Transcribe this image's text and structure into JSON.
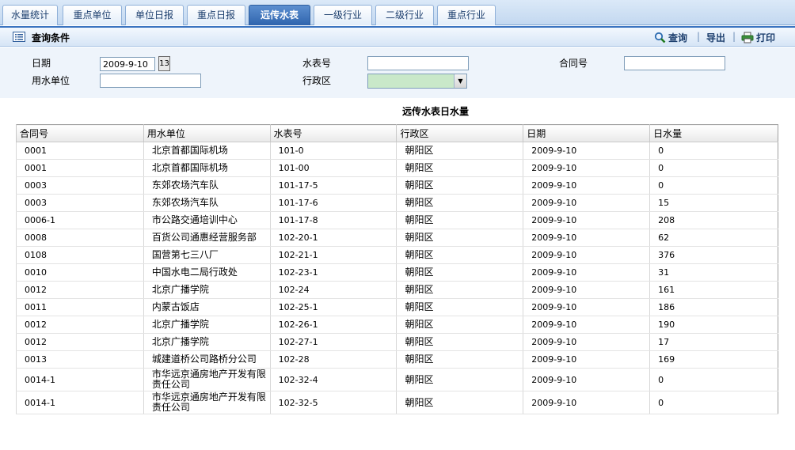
{
  "tabs": [
    {
      "label": "水量统计",
      "active": false
    },
    {
      "label": "重点单位",
      "active": false
    },
    {
      "label": "单位日报",
      "active": false
    },
    {
      "label": "重点日报",
      "active": false
    },
    {
      "label": "远传水表",
      "active": true
    },
    {
      "label": "一级行业",
      "active": false
    },
    {
      "label": "二级行业",
      "active": false
    },
    {
      "label": "重点行业",
      "active": false
    }
  ],
  "query_bar": {
    "title": "查询条件",
    "search_label": "查询",
    "export_label": "导出",
    "print_label": "打印"
  },
  "form": {
    "date_label": "日期",
    "date_value": "2009-9-10",
    "calendar_button": "13",
    "meter_label": "水表号",
    "meter_value": "",
    "contract_label": "合同号",
    "contract_value": "",
    "unit_label": "用水单位",
    "unit_value": "",
    "district_label": "行政区",
    "district_value": ""
  },
  "report_title": "远传水表日水量",
  "table": {
    "columns": [
      "合同号",
      "用水单位",
      "水表号",
      "行政区",
      "日期",
      "日水量"
    ],
    "rows": [
      [
        "0001",
        "北京首都国际机场",
        "101-0",
        "朝阳区",
        "2009-9-10",
        "0"
      ],
      [
        "0001",
        "北京首都国际机场",
        "101-00",
        "朝阳区",
        "2009-9-10",
        "0"
      ],
      [
        "0003",
        "东郊农场汽车队",
        "101-17-5",
        "朝阳区",
        "2009-9-10",
        "0"
      ],
      [
        "0003",
        "东郊农场汽车队",
        "101-17-6",
        "朝阳区",
        "2009-9-10",
        "15"
      ],
      [
        "0006-1",
        "市公路交通培训中心",
        "101-17-8",
        "朝阳区",
        "2009-9-10",
        "208"
      ],
      [
        "0008",
        "百货公司通惠经营服务部",
        "102-20-1",
        "朝阳区",
        "2009-9-10",
        "62"
      ],
      [
        "0108",
        "国营第七三八厂",
        "102-21-1",
        "朝阳区",
        "2009-9-10",
        "376"
      ],
      [
        "0010",
        "中国水电二局行政处",
        "102-23-1",
        "朝阳区",
        "2009-9-10",
        "31"
      ],
      [
        "0012",
        "北京广播学院",
        "102-24",
        "朝阳区",
        "2009-9-10",
        "161"
      ],
      [
        "0011",
        "内蒙古饭店",
        "102-25-1",
        "朝阳区",
        "2009-9-10",
        "186"
      ],
      [
        "0012",
        "北京广播学院",
        "102-26-1",
        "朝阳区",
        "2009-9-10",
        "190"
      ],
      [
        "0012",
        "北京广播学院",
        "102-27-1",
        "朝阳区",
        "2009-9-10",
        "17"
      ],
      [
        "0013",
        "城建道桥公司路桥分公司",
        "102-28",
        "朝阳区",
        "2009-9-10",
        "169"
      ],
      [
        "0014-1",
        "市华远京通房地产开发有限责任公司",
        "102-32-4",
        "朝阳区",
        "2009-9-10",
        "0"
      ],
      [
        "0014-1",
        "市华远京通房地产开发有限责任公司",
        "102-32-5",
        "朝阳区",
        "2009-9-10",
        "0"
      ]
    ]
  }
}
